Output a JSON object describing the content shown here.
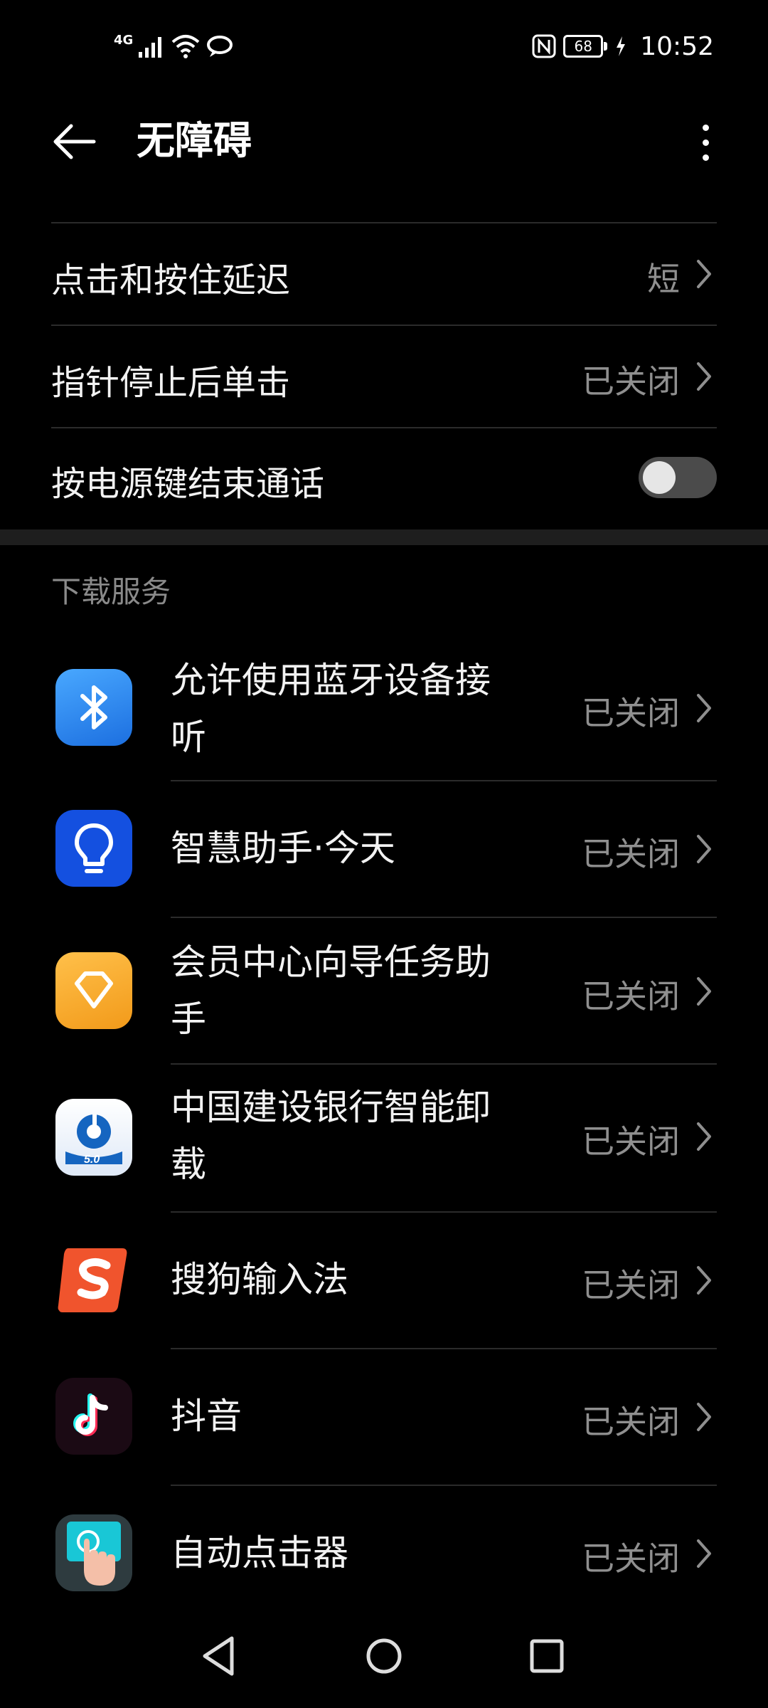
{
  "status_bar": {
    "network": "4G",
    "battery": "68",
    "time": "10:52",
    "icons": [
      "signal-icon",
      "wifi-icon",
      "hotspot-icon",
      "nfc-icon",
      "battery-icon",
      "charging-icon"
    ]
  },
  "header": {
    "title": "无障碍",
    "back_icon": "back-arrow-icon",
    "more_icon": "more-vertical-icon"
  },
  "settings": [
    {
      "label": "点击和按住延迟",
      "value": "短"
    },
    {
      "label": "指针停止后单击",
      "value": "已关闭"
    },
    {
      "label": "按电源键结束通话",
      "toggle": false
    }
  ],
  "download_services": {
    "title": "下载服务",
    "items": [
      {
        "label": "允许使用蓝牙设备接听",
        "value": "已关闭",
        "icon": "bluetooth-icon",
        "color": "#2f8cf0"
      },
      {
        "label": "智慧助手·今天",
        "value": "已关闭",
        "icon": "lightbulb-icon",
        "color": "#1450e0"
      },
      {
        "label": "会员中心向导任务助手",
        "value": "已关闭",
        "icon": "diamond-icon",
        "color": "#f6a524"
      },
      {
        "label": "中国建设银行智能卸载",
        "value": "已关闭",
        "icon": "ccb-logo-icon",
        "color": "#1565c0"
      },
      {
        "label": "搜狗输入法",
        "value": "已关闭",
        "icon": "sogou-icon",
        "color": "#f0542d"
      },
      {
        "label": "抖音",
        "value": "已关闭",
        "icon": "tiktok-icon",
        "color": "#1b0a14"
      },
      {
        "label": "自动点击器",
        "value": "已关闭",
        "icon": "auto-clicker-icon",
        "color": "#19c7d6"
      }
    ]
  },
  "nav_bar": {
    "icons": [
      "nav-back-icon",
      "nav-home-icon",
      "nav-recents-icon"
    ]
  }
}
